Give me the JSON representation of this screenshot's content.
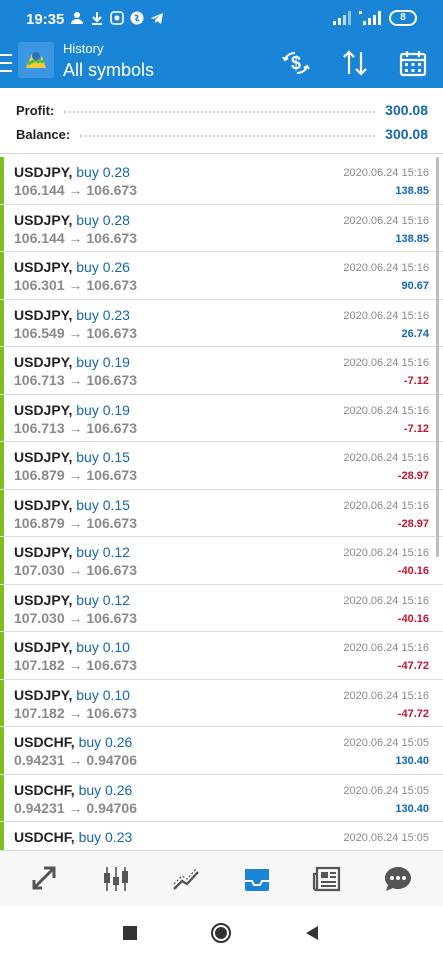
{
  "status_bar": {
    "time": "19:35",
    "battery": "8"
  },
  "app_bar": {
    "title_small": "History",
    "title_big": "All symbols"
  },
  "summary": {
    "profit_label": "Profit:",
    "profit_value": "300.08",
    "balance_label": "Balance:",
    "balance_value": "300.08"
  },
  "colors": {
    "accent": "#1a84d6",
    "buy_bar": "#7cbf1e",
    "positive": "#1466b2",
    "negative": "#c4172b"
  },
  "trades": [
    {
      "symbol": "USDJPY,",
      "action": "buy 0.28",
      "open": "106.144",
      "close": "106.673",
      "time": "2020.06.24 15:16",
      "profit": "138.85",
      "sign": "pos"
    },
    {
      "symbol": "USDJPY,",
      "action": "buy 0.28",
      "open": "106.144",
      "close": "106.673",
      "time": "2020.06.24 15:16",
      "profit": "138.85",
      "sign": "pos"
    },
    {
      "symbol": "USDJPY,",
      "action": "buy 0.26",
      "open": "106.301",
      "close": "106.673",
      "time": "2020.06.24 15:16",
      "profit": "90.67",
      "sign": "pos"
    },
    {
      "symbol": "USDJPY,",
      "action": "buy 0.23",
      "open": "106.549",
      "close": "106.673",
      "time": "2020.06.24 15:16",
      "profit": "26.74",
      "sign": "pos"
    },
    {
      "symbol": "USDJPY,",
      "action": "buy 0.19",
      "open": "106.713",
      "close": "106.673",
      "time": "2020.06.24 15:16",
      "profit": "-7.12",
      "sign": "neg"
    },
    {
      "symbol": "USDJPY,",
      "action": "buy 0.19",
      "open": "106.713",
      "close": "106.673",
      "time": "2020.06.24 15:16",
      "profit": "-7.12",
      "sign": "neg"
    },
    {
      "symbol": "USDJPY,",
      "action": "buy 0.15",
      "open": "106.879",
      "close": "106.673",
      "time": "2020.06.24 15:16",
      "profit": "-28.97",
      "sign": "neg"
    },
    {
      "symbol": "USDJPY,",
      "action": "buy 0.15",
      "open": "106.879",
      "close": "106.673",
      "time": "2020.06.24 15:16",
      "profit": "-28.97",
      "sign": "neg"
    },
    {
      "symbol": "USDJPY,",
      "action": "buy 0.12",
      "open": "107.030",
      "close": "106.673",
      "time": "2020.06.24 15:16",
      "profit": "-40.16",
      "sign": "neg"
    },
    {
      "symbol": "USDJPY,",
      "action": "buy 0.12",
      "open": "107.030",
      "close": "106.673",
      "time": "2020.06.24 15:16",
      "profit": "-40.16",
      "sign": "neg"
    },
    {
      "symbol": "USDJPY,",
      "action": "buy 0.10",
      "open": "107.182",
      "close": "106.673",
      "time": "2020.06.24 15:16",
      "profit": "-47.72",
      "sign": "neg"
    },
    {
      "symbol": "USDJPY,",
      "action": "buy 0.10",
      "open": "107.182",
      "close": "106.673",
      "time": "2020.06.24 15:16",
      "profit": "-47.72",
      "sign": "neg"
    },
    {
      "symbol": "USDCHF,",
      "action": "buy 0.26",
      "open": "0.94231",
      "close": "0.94706",
      "time": "2020.06.24 15:05",
      "profit": "130.40",
      "sign": "pos"
    },
    {
      "symbol": "USDCHF,",
      "action": "buy 0.26",
      "open": "0.94231",
      "close": "0.94706",
      "time": "2020.06.24 15:05",
      "profit": "130.40",
      "sign": "pos"
    },
    {
      "symbol": "USDCHF,",
      "action": "buy 0.23",
      "open": "",
      "close": "",
      "time": "2020.06.24 15:05",
      "profit": "",
      "sign": "pos"
    }
  ],
  "arrow": "→",
  "bottom_nav": [
    "quotes-icon",
    "chart-icon",
    "trade-icon",
    "history-icon",
    "news-icon",
    "messages-icon"
  ],
  "active_nav": "history-icon"
}
